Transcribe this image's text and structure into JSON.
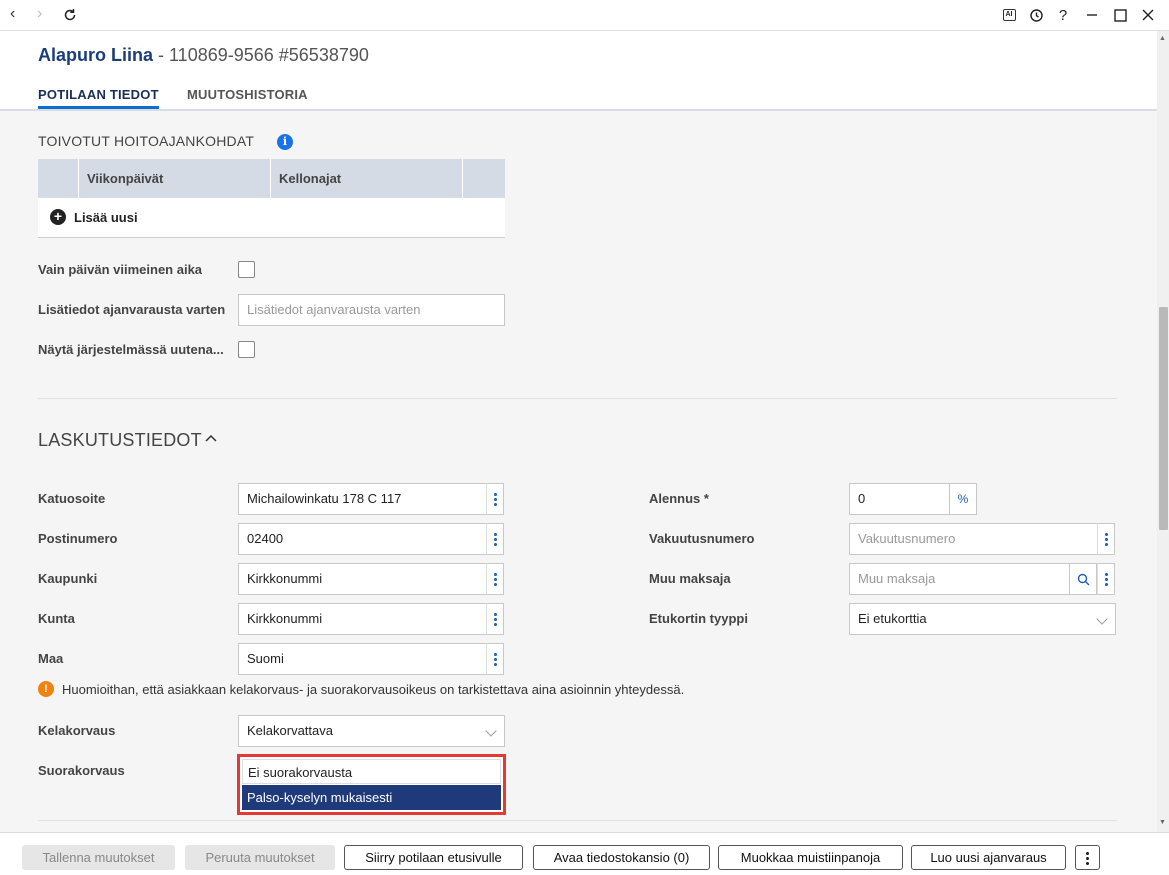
{
  "window": {
    "back_icon": "‹",
    "forward_icon": "›",
    "ai_badge": "AI"
  },
  "patient": {
    "name": "Alapuro Liina",
    "ids": " - 110869-9566 #56538790"
  },
  "tabs": [
    {
      "label": "POTILAAN TIEDOT",
      "active": true
    },
    {
      "label": "MUUTOSHISTORIA",
      "active": false
    }
  ],
  "appointment_times": {
    "title": "TOIVOTUT HOITOAJANKOHDAT",
    "columns": [
      "Viikonpäivät",
      "Kellonajat"
    ],
    "add_new_label": "Lisää uusi",
    "last_time_of_day_label": "Vain päivän viimeinen aika",
    "extra_info_label": "Lisätiedot ajanvarausta varten",
    "extra_info_placeholder": "Lisätiedot ajanvarausta varten",
    "show_as_new_label": "Näytä järjestelmässä uutena..."
  },
  "billing": {
    "title": "LASKUTUSTIEDOT",
    "street_label": "Katuosoite",
    "street_value": "Michailowinkatu 178 C 117",
    "postal_label": "Postinumero",
    "postal_value": "02400",
    "city_label": "Kaupunki",
    "city_value": "Kirkkonummi",
    "municipality_label": "Kunta",
    "municipality_value": "Kirkkonummi",
    "country_label": "Maa",
    "country_value": "Suomi",
    "discount_label": "Alennus *",
    "discount_value": "0",
    "discount_unit": "%",
    "insurance_label": "Vakuutusnumero",
    "insurance_placeholder": "Vakuutusnumero",
    "other_payer_label": "Muu maksaja",
    "other_payer_placeholder": "Muu maksaja",
    "benefit_card_label": "Etukortin tyyppi",
    "benefit_card_value": "Ei etukorttia",
    "notice": "Huomioithan, että asiakkaan kelakorvaus- ja suorakorvausoikeus on tarkistettava aina asioinnin yhteydessä.",
    "kela_label": "Kelakorvaus",
    "kela_value": "Kelakorvattava",
    "direct_label": "Suorakorvaus",
    "direct_options": [
      "Ei suorakorvausta",
      "Palso-kyselyn mukaisesti"
    ]
  },
  "footer": {
    "save": "Tallenna muutokset",
    "cancel": "Peruuta muutokset",
    "go_front": "Siirry potilaan etusivulle",
    "open_folder": "Avaa tiedostokansio (0)",
    "edit_notes": "Muokkaa muistiinpanoja",
    "new_booking": "Luo uusi ajanvaraus"
  }
}
